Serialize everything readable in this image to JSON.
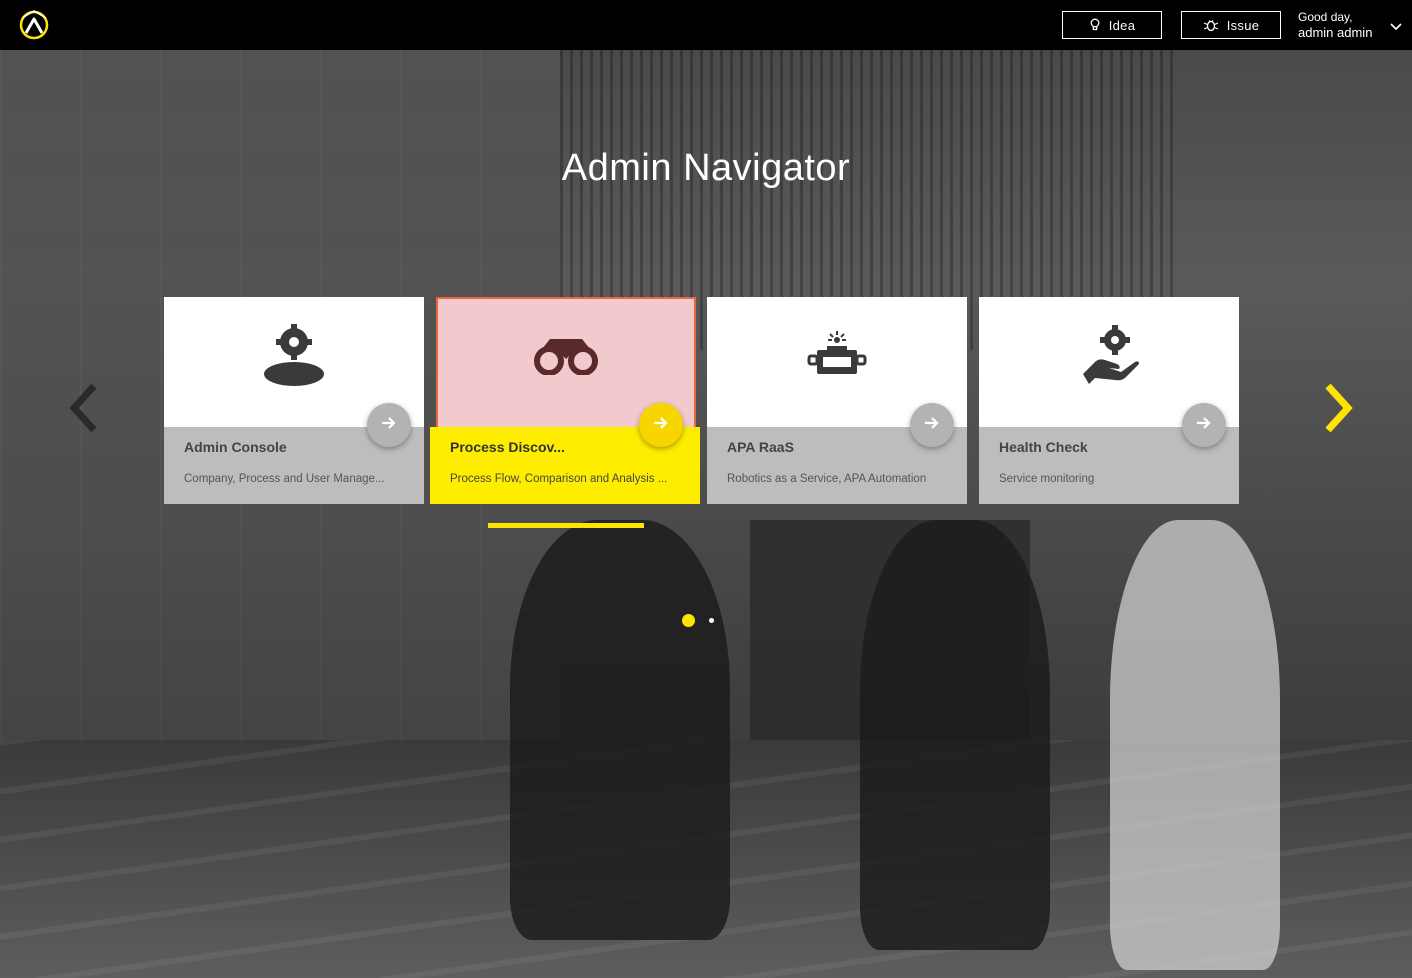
{
  "header": {
    "idea_label": "Idea",
    "issue_label": "Issue",
    "greeting_line1": "Good day,",
    "greeting_line2": "admin admin"
  },
  "page": {
    "title": "Admin Navigator"
  },
  "cards": [
    {
      "title": "Admin Console",
      "description": "Company, Process and User Manage...",
      "icon": "user-gear-icon"
    },
    {
      "title": "Process Discov...",
      "description": "Process Flow, Comparison and Analysis ...",
      "icon": "binoculars-icon"
    },
    {
      "title": "APA RaaS",
      "description": "Robotics as a Service, APA Automation",
      "icon": "robot-icon"
    },
    {
      "title": "Health Check",
      "description": "Service monitoring",
      "icon": "hand-gear-icon"
    }
  ],
  "carousel": {
    "page_count": 2,
    "active_page": 1,
    "active_card": 2
  },
  "colors": {
    "accent": "#ffe400",
    "topbar": "#000000",
    "card_footer": "#bdbdbd",
    "active_highlight": "#f2c9cd",
    "active_border": "#e8673c",
    "icon_dark": "#3a3a3a",
    "icon_active": "#5a2a2a"
  }
}
